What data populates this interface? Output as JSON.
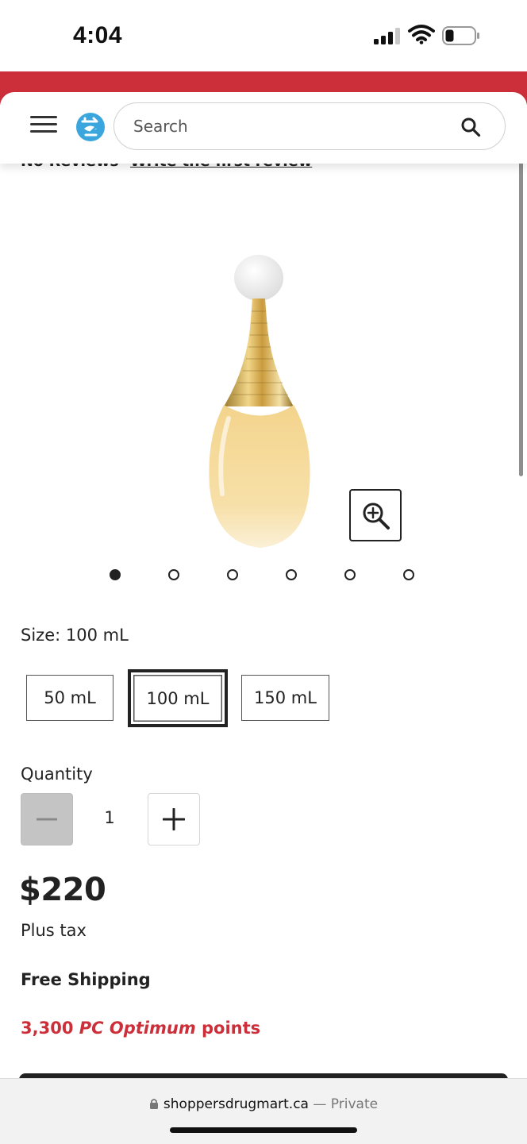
{
  "status": {
    "time": "4:04",
    "icons": [
      "cellular-signal-icon",
      "wifi-icon",
      "battery-icon"
    ]
  },
  "header": {
    "menu_icon": "hamburger-menu-icon",
    "logo_icon": "shoppers-logo-icon",
    "search_placeholder": "Search",
    "search_icon": "search-icon",
    "brand_color": "#cc2f3a"
  },
  "reviews": {
    "count_text": "No Reviews",
    "write_link": "Write the first review"
  },
  "gallery": {
    "image": "perfume-bottle-image",
    "zoom_icon": "zoom-in-icon",
    "slide_count": 6,
    "active_slide": 1
  },
  "size": {
    "label": "Size: 100 mL",
    "options": [
      "50 mL",
      "100 mL",
      "150 mL"
    ],
    "selected": "100 mL"
  },
  "quantity": {
    "label": "Quantity",
    "value": "1",
    "minus_icon": "minus-icon",
    "plus_icon": "plus-icon"
  },
  "price": {
    "amount": "$220",
    "tax_note": "Plus tax"
  },
  "shipping": "Free Shipping",
  "points": {
    "amount": "3,300",
    "brand": "PC Optimum",
    "suffix": "points"
  },
  "browser": {
    "url": "shoppersdrugmart.ca",
    "separator": "—",
    "mode": "Private"
  }
}
